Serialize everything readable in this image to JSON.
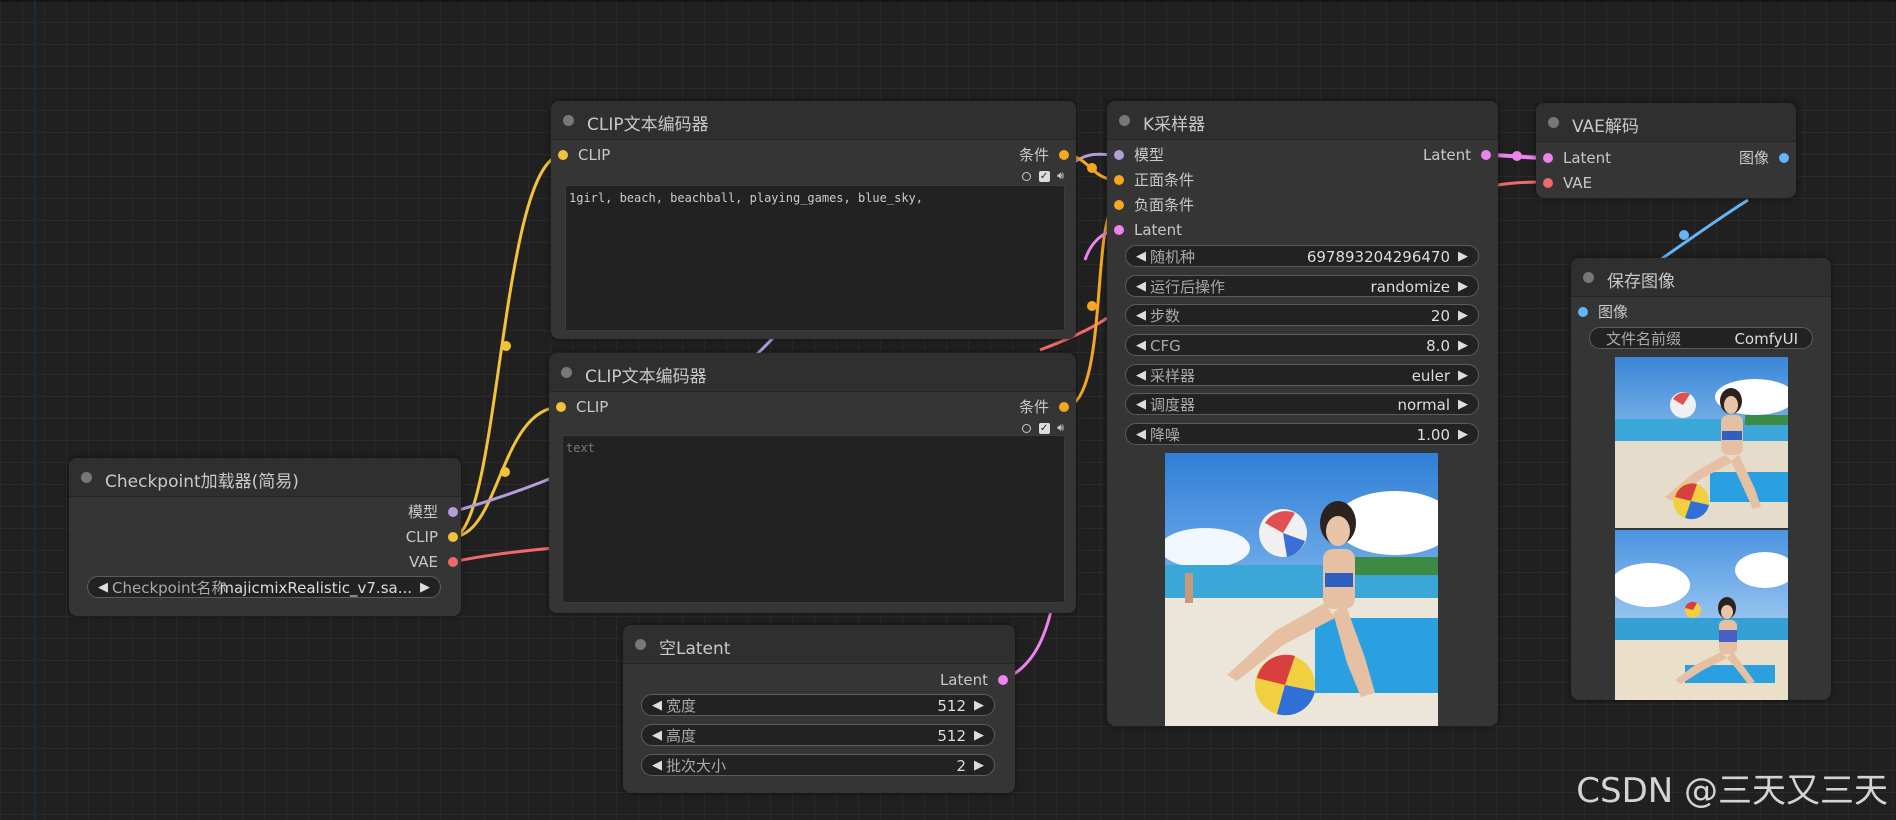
{
  "colors": {
    "clip": "#f2c23a",
    "model": "#b39ddb",
    "vae": "#ef6a6a",
    "latent": "#ee82ee",
    "conditioning": "#f5a623",
    "image": "#64b5f6"
  },
  "nodes": {
    "clip_text_1": {
      "title": "CLIP文本编码器",
      "input_clip": "CLIP",
      "output": "条件",
      "text": "1girl, beach, beachball, playing_games, blue_sky,"
    },
    "clip_text_2": {
      "title": "CLIP文本编码器",
      "input_clip": "CLIP",
      "output": "条件",
      "placeholder": "text"
    },
    "checkpoint": {
      "title": "Checkpoint加载器(简易)",
      "outputs": [
        "模型",
        "CLIP",
        "VAE"
      ],
      "widget_label": "Checkpoint名称",
      "widget_value": "majicmixRealistic_v7.sa..."
    },
    "empty_latent": {
      "title": "空Latent",
      "output": "Latent",
      "widgets": [
        {
          "label": "宽度",
          "value": "512"
        },
        {
          "label": "高度",
          "value": "512"
        },
        {
          "label": "批次大小",
          "value": "2"
        }
      ]
    },
    "ksampler": {
      "title": "K采样器",
      "inputs": [
        "模型",
        "正面条件",
        "负面条件",
        "Latent"
      ],
      "output": "Latent",
      "widgets": [
        {
          "label": "随机种",
          "value": "697893204296470"
        },
        {
          "label": "运行后操作",
          "value": "randomize"
        },
        {
          "label": "步数",
          "value": "20"
        },
        {
          "label": "CFG",
          "value": "8.0"
        },
        {
          "label": "采样器",
          "value": "euler"
        },
        {
          "label": "调度器",
          "value": "normal"
        },
        {
          "label": "降噪",
          "value": "1.00"
        }
      ]
    },
    "vae_decode": {
      "title": "VAE解码",
      "inputs": [
        "Latent",
        "VAE"
      ],
      "output": "图像"
    },
    "save_image": {
      "title": "保存图像",
      "input": "图像",
      "widget_label": "文件名前缀",
      "widget_value": "ComfyUI"
    }
  },
  "watermark": "CSDN @三天又三天"
}
